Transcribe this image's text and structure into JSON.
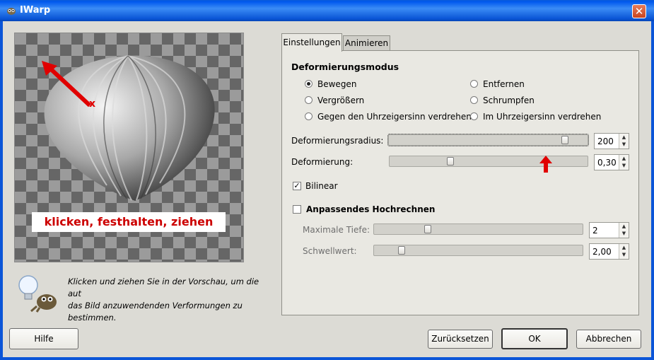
{
  "window": {
    "title": "IWarp",
    "close_glyph": "✕"
  },
  "preview": {
    "overlay_text": "klicken, festhalten, ziehen",
    "marker_label": "x"
  },
  "hint": {
    "text": "Klicken und ziehen Sie in der Vorschau, um die aut\ndas Bild anzuwendenden Verformungen zu\nbestimmen."
  },
  "tabs": [
    {
      "label": "Einstellungen",
      "active": true
    },
    {
      "label": "Animieren",
      "active": false
    }
  ],
  "settings": {
    "mode_heading": "Deformierungsmodus",
    "modes": [
      {
        "label": "Bewegen",
        "selected": true
      },
      {
        "label": "Entfernen",
        "selected": false
      },
      {
        "label": "Vergrößern",
        "selected": false
      },
      {
        "label": "Schrumpfen",
        "selected": false
      },
      {
        "label": "Gegen den Uhrzeigersinn verdrehen",
        "selected": false
      },
      {
        "label": "Im Uhrzeigersinn verdrehen",
        "selected": false
      }
    ],
    "radius": {
      "label": "Deformierungsradius:",
      "value": "200",
      "fraction": 0.9
    },
    "amount": {
      "label": "Deformierung:",
      "value": "0,30",
      "fraction": 0.3
    },
    "bilinear": {
      "label": "Bilinear",
      "checked": true
    },
    "adaptive": {
      "label": "Anpassendes Hochrechnen",
      "checked": false,
      "max_depth": {
        "label": "Maximale Tiefe:",
        "value": "2",
        "fraction": 0.25
      },
      "threshold": {
        "label": "Schwellwert:",
        "value": "2,00",
        "fraction": 0.12
      }
    }
  },
  "buttons": {
    "help": "Hilfe",
    "reset": "Zurücksetzen",
    "ok": "OK",
    "cancel": "Abbrechen"
  },
  "colors": {
    "accent_red": "#cc0000",
    "titlebar_blue": "#0058ee"
  }
}
